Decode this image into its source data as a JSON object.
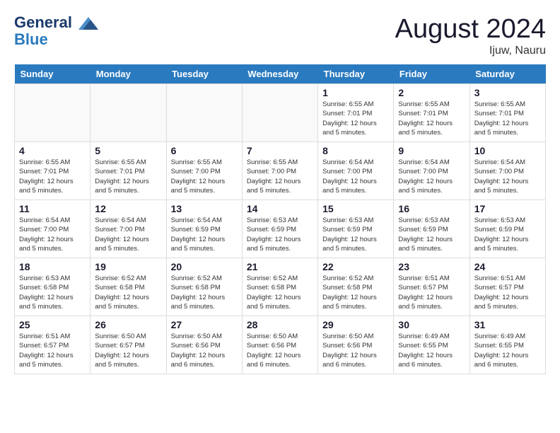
{
  "header": {
    "logo_line1": "General",
    "logo_line2": "Blue",
    "month_title": "August 2024",
    "location": "Ijuw, Nauru"
  },
  "weekdays": [
    "Sunday",
    "Monday",
    "Tuesday",
    "Wednesday",
    "Thursday",
    "Friday",
    "Saturday"
  ],
  "weeks": [
    [
      {
        "day": "",
        "info": ""
      },
      {
        "day": "",
        "info": ""
      },
      {
        "day": "",
        "info": ""
      },
      {
        "day": "",
        "info": ""
      },
      {
        "day": "1",
        "info": "Sunrise: 6:55 AM\nSunset: 7:01 PM\nDaylight: 12 hours\nand 5 minutes."
      },
      {
        "day": "2",
        "info": "Sunrise: 6:55 AM\nSunset: 7:01 PM\nDaylight: 12 hours\nand 5 minutes."
      },
      {
        "day": "3",
        "info": "Sunrise: 6:55 AM\nSunset: 7:01 PM\nDaylight: 12 hours\nand 5 minutes."
      }
    ],
    [
      {
        "day": "4",
        "info": "Sunrise: 6:55 AM\nSunset: 7:01 PM\nDaylight: 12 hours\nand 5 minutes."
      },
      {
        "day": "5",
        "info": "Sunrise: 6:55 AM\nSunset: 7:01 PM\nDaylight: 12 hours\nand 5 minutes."
      },
      {
        "day": "6",
        "info": "Sunrise: 6:55 AM\nSunset: 7:00 PM\nDaylight: 12 hours\nand 5 minutes."
      },
      {
        "day": "7",
        "info": "Sunrise: 6:55 AM\nSunset: 7:00 PM\nDaylight: 12 hours\nand 5 minutes."
      },
      {
        "day": "8",
        "info": "Sunrise: 6:54 AM\nSunset: 7:00 PM\nDaylight: 12 hours\nand 5 minutes."
      },
      {
        "day": "9",
        "info": "Sunrise: 6:54 AM\nSunset: 7:00 PM\nDaylight: 12 hours\nand 5 minutes."
      },
      {
        "day": "10",
        "info": "Sunrise: 6:54 AM\nSunset: 7:00 PM\nDaylight: 12 hours\nand 5 minutes."
      }
    ],
    [
      {
        "day": "11",
        "info": "Sunrise: 6:54 AM\nSunset: 7:00 PM\nDaylight: 12 hours\nand 5 minutes."
      },
      {
        "day": "12",
        "info": "Sunrise: 6:54 AM\nSunset: 7:00 PM\nDaylight: 12 hours\nand 5 minutes."
      },
      {
        "day": "13",
        "info": "Sunrise: 6:54 AM\nSunset: 6:59 PM\nDaylight: 12 hours\nand 5 minutes."
      },
      {
        "day": "14",
        "info": "Sunrise: 6:53 AM\nSunset: 6:59 PM\nDaylight: 12 hours\nand 5 minutes."
      },
      {
        "day": "15",
        "info": "Sunrise: 6:53 AM\nSunset: 6:59 PM\nDaylight: 12 hours\nand 5 minutes."
      },
      {
        "day": "16",
        "info": "Sunrise: 6:53 AM\nSunset: 6:59 PM\nDaylight: 12 hours\nand 5 minutes."
      },
      {
        "day": "17",
        "info": "Sunrise: 6:53 AM\nSunset: 6:59 PM\nDaylight: 12 hours\nand 5 minutes."
      }
    ],
    [
      {
        "day": "18",
        "info": "Sunrise: 6:53 AM\nSunset: 6:58 PM\nDaylight: 12 hours\nand 5 minutes."
      },
      {
        "day": "19",
        "info": "Sunrise: 6:52 AM\nSunset: 6:58 PM\nDaylight: 12 hours\nand 5 minutes."
      },
      {
        "day": "20",
        "info": "Sunrise: 6:52 AM\nSunset: 6:58 PM\nDaylight: 12 hours\nand 5 minutes."
      },
      {
        "day": "21",
        "info": "Sunrise: 6:52 AM\nSunset: 6:58 PM\nDaylight: 12 hours\nand 5 minutes."
      },
      {
        "day": "22",
        "info": "Sunrise: 6:52 AM\nSunset: 6:58 PM\nDaylight: 12 hours\nand 5 minutes."
      },
      {
        "day": "23",
        "info": "Sunrise: 6:51 AM\nSunset: 6:57 PM\nDaylight: 12 hours\nand 5 minutes."
      },
      {
        "day": "24",
        "info": "Sunrise: 6:51 AM\nSunset: 6:57 PM\nDaylight: 12 hours\nand 5 minutes."
      }
    ],
    [
      {
        "day": "25",
        "info": "Sunrise: 6:51 AM\nSunset: 6:57 PM\nDaylight: 12 hours\nand 5 minutes."
      },
      {
        "day": "26",
        "info": "Sunrise: 6:50 AM\nSunset: 6:57 PM\nDaylight: 12 hours\nand 5 minutes."
      },
      {
        "day": "27",
        "info": "Sunrise: 6:50 AM\nSunset: 6:56 PM\nDaylight: 12 hours\nand 6 minutes."
      },
      {
        "day": "28",
        "info": "Sunrise: 6:50 AM\nSunset: 6:56 PM\nDaylight: 12 hours\nand 6 minutes."
      },
      {
        "day": "29",
        "info": "Sunrise: 6:50 AM\nSunset: 6:56 PM\nDaylight: 12 hours\nand 6 minutes."
      },
      {
        "day": "30",
        "info": "Sunrise: 6:49 AM\nSunset: 6:55 PM\nDaylight: 12 hours\nand 6 minutes."
      },
      {
        "day": "31",
        "info": "Sunrise: 6:49 AM\nSunset: 6:55 PM\nDaylight: 12 hours\nand 6 minutes."
      }
    ]
  ]
}
